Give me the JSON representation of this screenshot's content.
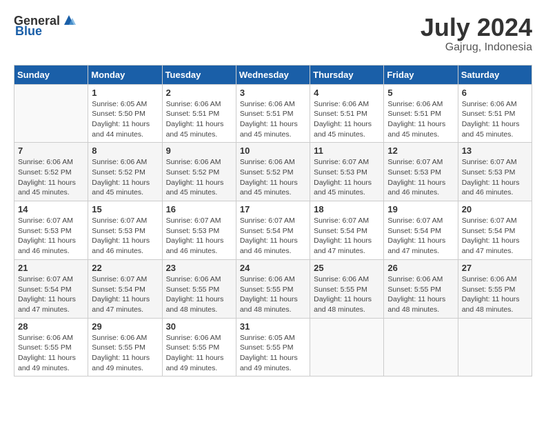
{
  "header": {
    "logo_general": "General",
    "logo_blue": "Blue",
    "month_year": "July 2024",
    "location": "Gajrug, Indonesia"
  },
  "weekdays": [
    "Sunday",
    "Monday",
    "Tuesday",
    "Wednesday",
    "Thursday",
    "Friday",
    "Saturday"
  ],
  "weeks": [
    [
      {
        "day": "",
        "info": ""
      },
      {
        "day": "1",
        "info": "Sunrise: 6:05 AM\nSunset: 5:50 PM\nDaylight: 11 hours\nand 44 minutes."
      },
      {
        "day": "2",
        "info": "Sunrise: 6:06 AM\nSunset: 5:51 PM\nDaylight: 11 hours\nand 45 minutes."
      },
      {
        "day": "3",
        "info": "Sunrise: 6:06 AM\nSunset: 5:51 PM\nDaylight: 11 hours\nand 45 minutes."
      },
      {
        "day": "4",
        "info": "Sunrise: 6:06 AM\nSunset: 5:51 PM\nDaylight: 11 hours\nand 45 minutes."
      },
      {
        "day": "5",
        "info": "Sunrise: 6:06 AM\nSunset: 5:51 PM\nDaylight: 11 hours\nand 45 minutes."
      },
      {
        "day": "6",
        "info": "Sunrise: 6:06 AM\nSunset: 5:51 PM\nDaylight: 11 hours\nand 45 minutes."
      }
    ],
    [
      {
        "day": "7",
        "info": "Sunrise: 6:06 AM\nSunset: 5:52 PM\nDaylight: 11 hours\nand 45 minutes."
      },
      {
        "day": "8",
        "info": "Sunrise: 6:06 AM\nSunset: 5:52 PM\nDaylight: 11 hours\nand 45 minutes."
      },
      {
        "day": "9",
        "info": "Sunrise: 6:06 AM\nSunset: 5:52 PM\nDaylight: 11 hours\nand 45 minutes."
      },
      {
        "day": "10",
        "info": "Sunrise: 6:06 AM\nSunset: 5:52 PM\nDaylight: 11 hours\nand 45 minutes."
      },
      {
        "day": "11",
        "info": "Sunrise: 6:07 AM\nSunset: 5:53 PM\nDaylight: 11 hours\nand 45 minutes."
      },
      {
        "day": "12",
        "info": "Sunrise: 6:07 AM\nSunset: 5:53 PM\nDaylight: 11 hours\nand 46 minutes."
      },
      {
        "day": "13",
        "info": "Sunrise: 6:07 AM\nSunset: 5:53 PM\nDaylight: 11 hours\nand 46 minutes."
      }
    ],
    [
      {
        "day": "14",
        "info": "Sunrise: 6:07 AM\nSunset: 5:53 PM\nDaylight: 11 hours\nand 46 minutes."
      },
      {
        "day": "15",
        "info": "Sunrise: 6:07 AM\nSunset: 5:53 PM\nDaylight: 11 hours\nand 46 minutes."
      },
      {
        "day": "16",
        "info": "Sunrise: 6:07 AM\nSunset: 5:53 PM\nDaylight: 11 hours\nand 46 minutes."
      },
      {
        "day": "17",
        "info": "Sunrise: 6:07 AM\nSunset: 5:54 PM\nDaylight: 11 hours\nand 46 minutes."
      },
      {
        "day": "18",
        "info": "Sunrise: 6:07 AM\nSunset: 5:54 PM\nDaylight: 11 hours\nand 47 minutes."
      },
      {
        "day": "19",
        "info": "Sunrise: 6:07 AM\nSunset: 5:54 PM\nDaylight: 11 hours\nand 47 minutes."
      },
      {
        "day": "20",
        "info": "Sunrise: 6:07 AM\nSunset: 5:54 PM\nDaylight: 11 hours\nand 47 minutes."
      }
    ],
    [
      {
        "day": "21",
        "info": "Sunrise: 6:07 AM\nSunset: 5:54 PM\nDaylight: 11 hours\nand 47 minutes."
      },
      {
        "day": "22",
        "info": "Sunrise: 6:07 AM\nSunset: 5:54 PM\nDaylight: 11 hours\nand 47 minutes."
      },
      {
        "day": "23",
        "info": "Sunrise: 6:06 AM\nSunset: 5:55 PM\nDaylight: 11 hours\nand 48 minutes."
      },
      {
        "day": "24",
        "info": "Sunrise: 6:06 AM\nSunset: 5:55 PM\nDaylight: 11 hours\nand 48 minutes."
      },
      {
        "day": "25",
        "info": "Sunrise: 6:06 AM\nSunset: 5:55 PM\nDaylight: 11 hours\nand 48 minutes."
      },
      {
        "day": "26",
        "info": "Sunrise: 6:06 AM\nSunset: 5:55 PM\nDaylight: 11 hours\nand 48 minutes."
      },
      {
        "day": "27",
        "info": "Sunrise: 6:06 AM\nSunset: 5:55 PM\nDaylight: 11 hours\nand 48 minutes."
      }
    ],
    [
      {
        "day": "28",
        "info": "Sunrise: 6:06 AM\nSunset: 5:55 PM\nDaylight: 11 hours\nand 49 minutes."
      },
      {
        "day": "29",
        "info": "Sunrise: 6:06 AM\nSunset: 5:55 PM\nDaylight: 11 hours\nand 49 minutes."
      },
      {
        "day": "30",
        "info": "Sunrise: 6:06 AM\nSunset: 5:55 PM\nDaylight: 11 hours\nand 49 minutes."
      },
      {
        "day": "31",
        "info": "Sunrise: 6:05 AM\nSunset: 5:55 PM\nDaylight: 11 hours\nand 49 minutes."
      },
      {
        "day": "",
        "info": ""
      },
      {
        "day": "",
        "info": ""
      },
      {
        "day": "",
        "info": ""
      }
    ]
  ]
}
